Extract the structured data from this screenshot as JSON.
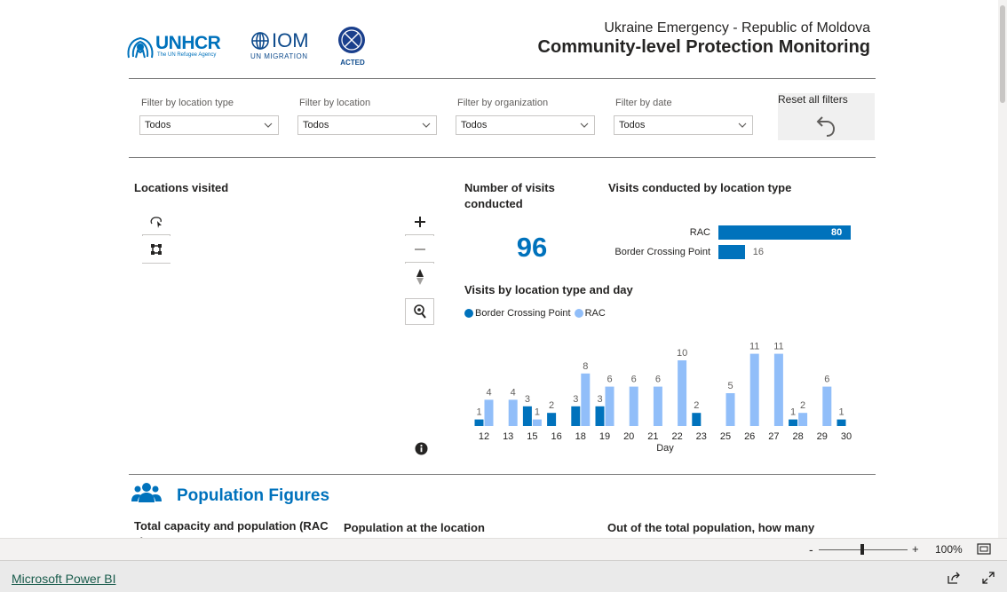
{
  "header": {
    "logos": {
      "unhcr_name": "UNHCR",
      "unhcr_tagline": "The UN Refugee Agency",
      "iom_name": "IOM",
      "iom_tagline": "UN MIGRATION",
      "acted_name": "ACTED"
    },
    "subtitle": "Ukraine Emergency - Republic of Moldova",
    "title": "Community-level Protection Monitoring"
  },
  "filters": [
    {
      "label": "Filter by location type",
      "value": "Todos"
    },
    {
      "label": "Filter by location",
      "value": "Todos"
    },
    {
      "label": "Filter by organization",
      "value": "Todos"
    },
    {
      "label": "Filter by date",
      "value": "Todos"
    }
  ],
  "reset": {
    "label": "Reset all filters",
    "icon": "undo-icon"
  },
  "map": {
    "title": "Locations visited",
    "tools": [
      "lasso-select-icon",
      "rect-select-icon"
    ],
    "controls": [
      "zoom-in-icon",
      "zoom-out-icon",
      "north-arrow-icon",
      "search-location-icon"
    ],
    "info_icon": "info-icon"
  },
  "kpi": {
    "title": "Number of visits conducted",
    "value": "96"
  },
  "by_type": {
    "title": "Visits conducted by location type",
    "colors": {
      "bar": "#0072bc",
      "label_inside": "#ffffff",
      "label_outside": "#605e5c"
    }
  },
  "by_day": {
    "title": "Visits by location type and day",
    "axis_label": "Day",
    "colors": {
      "Border Crossing Point": "#0072bc",
      "RAC": "#91bef9"
    }
  },
  "population": {
    "title": "Population Figures",
    "icon": "people-icon",
    "sub1": "Total capacity and population (RAC s)",
    "sub2": "Population at the location",
    "sub3": "Out of the total population, how many"
  },
  "statusbar": {
    "zoom": "100%"
  },
  "footer": {
    "link": "Microsoft Power BI"
  },
  "chart_data": [
    {
      "type": "bar",
      "title": "Visits conducted by location type",
      "orientation": "horizontal",
      "categories": [
        "RAC",
        "Border Crossing Point"
      ],
      "values": [
        80,
        16
      ],
      "labels": [
        "80",
        "16"
      ]
    },
    {
      "type": "bar",
      "title": "Visits by location type and day",
      "xlabel": "Day",
      "categories": [
        "12",
        "13",
        "15",
        "16",
        "18",
        "19",
        "20",
        "21",
        "22",
        "23",
        "25",
        "26",
        "27",
        "28",
        "29",
        "30"
      ],
      "legend": "top-left",
      "series": [
        {
          "name": "Border Crossing Point",
          "values": [
            1,
            null,
            3,
            2,
            3,
            3,
            null,
            null,
            null,
            2,
            null,
            null,
            null,
            1,
            null,
            1
          ]
        },
        {
          "name": "RAC",
          "values": [
            4,
            4,
            1,
            null,
            8,
            6,
            6,
            6,
            10,
            null,
            5,
            11,
            11,
            2,
            6,
            null
          ]
        }
      ]
    }
  ]
}
